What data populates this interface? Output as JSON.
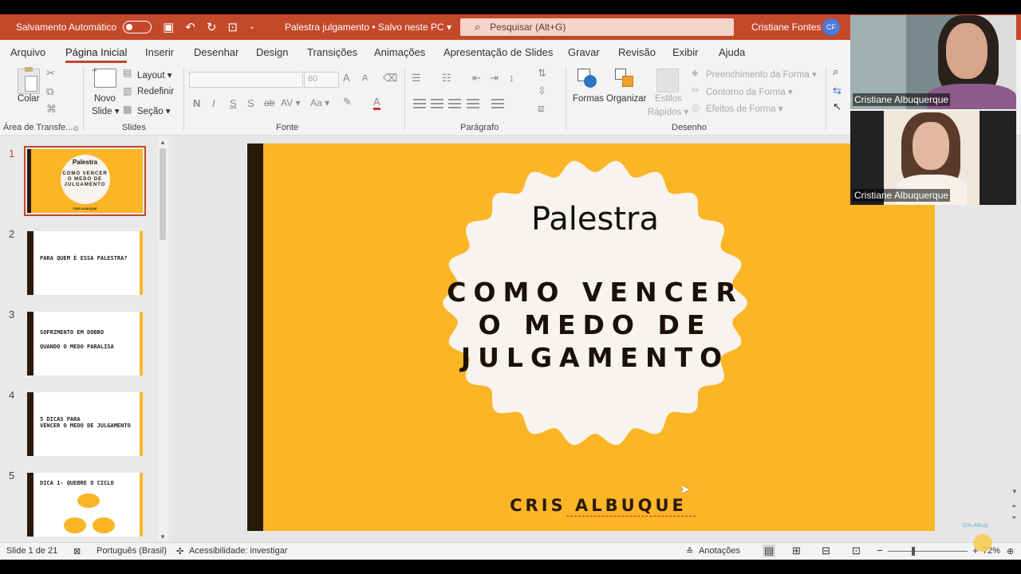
{
  "titlebar": {
    "autosave": "Salvamento Automático",
    "doc_title": "Palestra julgamento • Salvo neste PC ▾",
    "search_placeholder": "Pesquisar (Alt+G)",
    "user_name": "Cristiane Fontes",
    "user_initials": "CF"
  },
  "tabs": [
    "Arquivo",
    "Página Inicial",
    "Inserir",
    "Desenhar",
    "Design",
    "Transições",
    "Animações",
    "Apresentação de Slides",
    "Gravar",
    "Revisão",
    "Exibir",
    "Ajuda"
  ],
  "ribbon": {
    "clipboard": {
      "paste": "Colar",
      "group": "Área de Transfe..."
    },
    "slides": {
      "new_slide_1": "Novo",
      "new_slide_2": "Slide ▾",
      "layout": "Layout ▾",
      "reset": "Redefinir",
      "section": "Seção ▾",
      "group": "Slides"
    },
    "font": {
      "size": "60",
      "group": "Fonte",
      "bold": "N",
      "italic": "I",
      "underline": "S",
      "shadow": "S",
      "strike": "ab",
      "spacing": "AV ▾",
      "case": "Aa ▾",
      "grow": "A",
      "shrink": "A"
    },
    "paragraph": {
      "group": "Parágrafo"
    },
    "drawing": {
      "shapes": "Formas",
      "arrange": "Organizar",
      "quick_styles_1": "Estilos",
      "quick_styles_2": "Rápidos ▾",
      "fill": "Preenchimento da Forma ▾",
      "outline": "Contorno da Forma ▾",
      "effects": "Efeitos de Forma ▾",
      "group": "Desenho"
    }
  },
  "thumbnails": [
    {
      "num": "1",
      "lines": [
        "Palestra",
        "COMO VENCER",
        "O MEDO DE",
        "JULGAMENTO",
        "CRIS ALBUQUE"
      ]
    },
    {
      "num": "2",
      "lines": [
        "PARA QUEM É ESSA PALESTRA?"
      ]
    },
    {
      "num": "3",
      "lines": [
        "SOFRIMENTO EM DOBRO",
        "QUANDO O MEDO PARALISA"
      ]
    },
    {
      "num": "4",
      "lines": [
        "5 DICAS PARA",
        "VENCER O MEDO DE JULGAMENTO"
      ]
    },
    {
      "num": "5",
      "lines": [
        "DICA 1- QUEBRE O CICLO"
      ]
    }
  ],
  "slide": {
    "title": "Palestra",
    "heading_1": "COMO VENCER",
    "heading_2": "O MEDO DE",
    "heading_3": "JULGAMENTO",
    "author": "CRIS ALBUQUE"
  },
  "status": {
    "slide_of": "Slide 1 de 21",
    "language": "Português (Brasil)",
    "accessibility": "Acessibilidade: investigar",
    "notes": "Anotações",
    "zoom": "72%"
  },
  "video": [
    {
      "name": "Cristiane Albuquerque"
    },
    {
      "name": "Cristiane Albuquerque"
    }
  ],
  "colors": {
    "accent": "#c4482a",
    "slide_bg": "#fbb526",
    "dark_bar": "#2a1a0a"
  }
}
